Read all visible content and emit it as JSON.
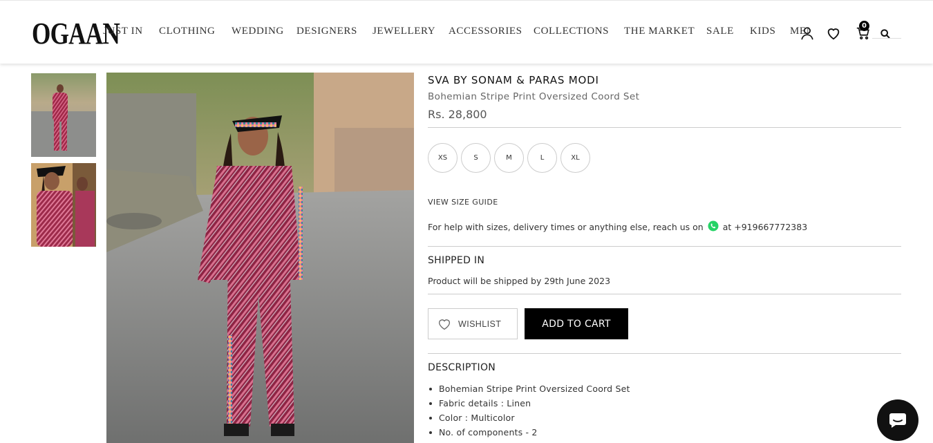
{
  "header": {
    "logo": "OGAAN",
    "nav": [
      {
        "label": "JUST IN"
      },
      {
        "label": "CLOTHING"
      },
      {
        "label": "WEDDING"
      },
      {
        "label": "DESIGNERS"
      },
      {
        "label": "JEWELLERY"
      },
      {
        "label": "ACCESSORIES"
      },
      {
        "label": "COLLECTIONS"
      },
      {
        "label": "THE MARKET"
      },
      {
        "label": "SALE"
      },
      {
        "label": "KIDS"
      },
      {
        "label": "MEN"
      }
    ],
    "cart_count": "0",
    "icons": [
      "user-icon",
      "heart-icon",
      "cart-icon",
      "search-icon"
    ]
  },
  "product": {
    "brand": "SVA BY SONAM & PARAS MODI",
    "name": "Bohemian Stripe Print Oversized Coord Set",
    "price": "Rs. 28,800",
    "sizes": [
      "XS",
      "S",
      "M",
      "L",
      "XL"
    ],
    "size_guide": "VIEW SIZE GUIDE",
    "help_prefix": "For help with sizes, delivery times or anything else, reach us on",
    "help_suffix": "at +919667772383",
    "shipped_title": "SHIPPED IN",
    "shipped_text": "Product will be shipped by 29th June 2023",
    "wishlist_label": "WISHLIST",
    "add_to_cart_label": "ADD TO CART",
    "description_title": "DESCRIPTION",
    "description": [
      "Bohemian Stripe Print Oversized Coord Set",
      "Fabric details : Linen",
      "Color : Multicolor",
      "No. of components - 2"
    ]
  },
  "colors": {
    "accent": "#000000",
    "whatsapp": "#25D366"
  }
}
